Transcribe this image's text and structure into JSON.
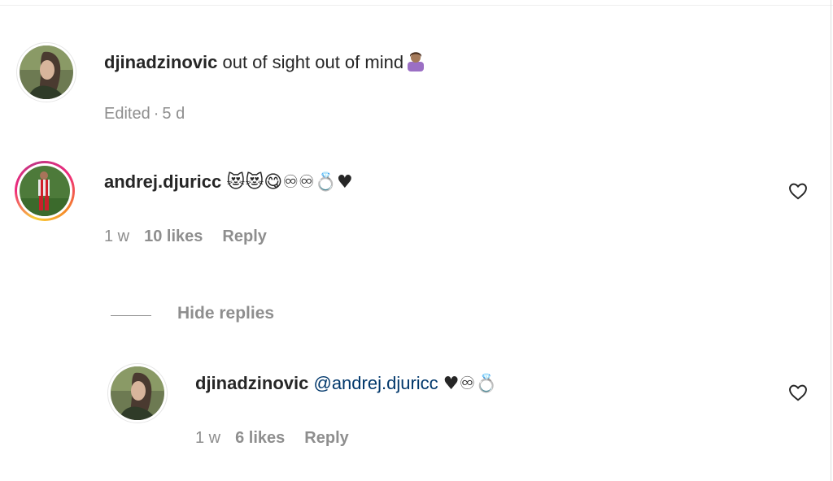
{
  "comments": [
    {
      "username": "djinadzinovic",
      "text": "out of sight out of mind",
      "emoji": "🙎",
      "meta": {
        "edited": "Edited",
        "sep": "·",
        "time": "5 d"
      }
    },
    {
      "username": "andrej.djuricc",
      "emoji": "😻😻😋♾♾💍♥",
      "meta": {
        "time": "1 w",
        "likes": "10 likes",
        "reply": "Reply"
      }
    }
  ],
  "replies_toggle": "Hide replies",
  "reply": {
    "username": "djinadzinovic",
    "mention": "@andrej.djuricc",
    "emoji": "♥♾💍",
    "meta": {
      "time": "1 w",
      "likes": "6 likes",
      "reply": "Reply"
    }
  }
}
